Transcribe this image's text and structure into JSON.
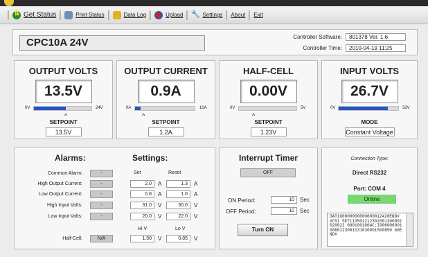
{
  "menu": {
    "get_status": "Get Status",
    "print_status": "Print Status",
    "data_log": "Data Log",
    "upload": "Upload",
    "settings": "Settings",
    "about": "About",
    "exit": "Exit"
  },
  "header": {
    "model": "CPC10A 24V",
    "software_label": "Controller Software:",
    "software_version": "801378  Ver. 1.6",
    "time_label": "Controller Time:",
    "time_value": "2010-04-19  11:25"
  },
  "meters": {
    "output_volts": {
      "title": "OUTPUT VOLTS",
      "value": "13.5V",
      "min": "0V",
      "max": "24V",
      "fill": 0.55,
      "sub": "SETPOINT",
      "sub_value": "13.5V"
    },
    "output_current": {
      "title": "OUTPUT CURRENT",
      "value": "0.9A",
      "min": "0A",
      "max": "10A",
      "fill": 0.09,
      "sub": "SETPOINT",
      "sub_value": "1.2A"
    },
    "half_cell": {
      "title": "HALF-CELL",
      "value": "0.00V",
      "min": "0V",
      "max": "5V",
      "fill": 0.0,
      "sub": "SETPOINT",
      "sub_value": "1.23V"
    },
    "input_volts": {
      "title": "INPUT VOLTS",
      "value": "26.7V",
      "min": "0V",
      "max": "32V",
      "fill": 0.83,
      "sub": "MODE",
      "sub_value": "Constant Voltage"
    }
  },
  "alarms": {
    "title": "Alarms:",
    "settings_title": "Settings:",
    "set_header": "Set",
    "reset_header": "Reset",
    "hi_header": "Hi V",
    "lo_header": "Lo V",
    "rows": [
      {
        "label": "Common Alarm:",
        "state": "-",
        "set": "",
        "set_unit": "",
        "reset": "",
        "reset_unit": ""
      },
      {
        "label": "High Output Current:",
        "state": "-",
        "set": "2.0",
        "set_unit": "A",
        "reset": "1.3",
        "reset_unit": "A"
      },
      {
        "label": "Low Output Current:",
        "state": "-",
        "set": "0.8",
        "set_unit": "A",
        "reset": "1.0",
        "reset_unit": "A"
      },
      {
        "label": "High Input Volts:",
        "state": "-",
        "set": "31.0",
        "set_unit": "V",
        "reset": "30.0",
        "reset_unit": "V"
      },
      {
        "label": "Low Input Volts:",
        "state": "-",
        "set": "20.0",
        "set_unit": "V",
        "reset": "22.0",
        "reset_unit": "V"
      },
      {
        "label": "Half-Cell:",
        "state": "N/A",
        "set": "1.50",
        "set_unit": "V",
        "reset": "0.85",
        "reset_unit": "V"
      }
    ]
  },
  "interrupt": {
    "title": "Interrupt Timer",
    "status": "OFF",
    "on_label": "ON Period:",
    "on_value": "10",
    "off_label": "OFF Period:",
    "off_value": "10",
    "unit": "Sec",
    "button": "Turn ON"
  },
  "connection": {
    "type_label": "Connection Type:",
    "type_value": "Direct RS232",
    "dash": "-",
    "port": "Port: COM 4",
    "status": "Online",
    "log_text": "DAT100000000000000012420END# #CS1 SET113501212302001300801020022 0001001004C:I0060060010060123001131030001500850 60END#"
  },
  "colors": {
    "bar_fill": "#2655c7",
    "online_bg": "#7bd86a"
  }
}
